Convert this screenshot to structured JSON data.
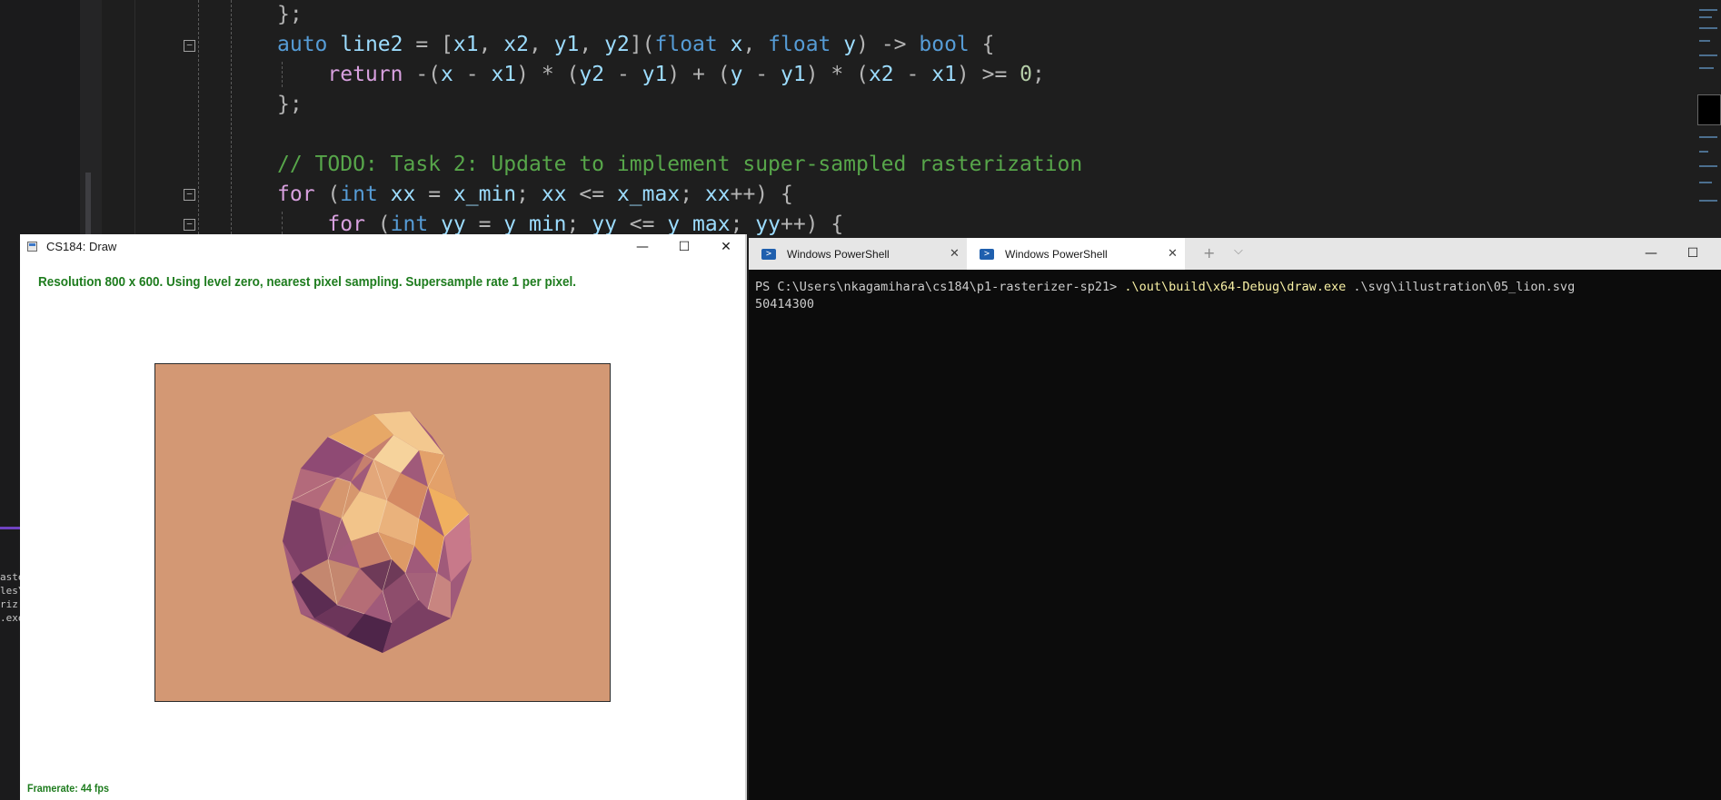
{
  "editor": {
    "lines": [
      {
        "tokens": [
          {
            "t": "};",
            "c": "op"
          }
        ]
      },
      {
        "tokens": [
          {
            "t": "auto ",
            "c": "kw"
          },
          {
            "t": "line2",
            "c": "id"
          },
          {
            "t": " = [",
            "c": "op"
          },
          {
            "t": "x1",
            "c": "id"
          },
          {
            "t": ", ",
            "c": "op"
          },
          {
            "t": "x2",
            "c": "id"
          },
          {
            "t": ", ",
            "c": "op"
          },
          {
            "t": "y1",
            "c": "id"
          },
          {
            "t": ", ",
            "c": "op"
          },
          {
            "t": "y2",
            "c": "id"
          },
          {
            "t": "](",
            "c": "op"
          },
          {
            "t": "float ",
            "c": "kw"
          },
          {
            "t": "x",
            "c": "id"
          },
          {
            "t": ", ",
            "c": "op"
          },
          {
            "t": "float ",
            "c": "kw"
          },
          {
            "t": "y",
            "c": "id"
          },
          {
            "t": ") -> ",
            "c": "op"
          },
          {
            "t": "bool",
            "c": "kw"
          },
          {
            "t": " {",
            "c": "op"
          }
        ]
      },
      {
        "tokens": [
          {
            "t": "    ",
            "c": "op"
          },
          {
            "t": "return ",
            "c": "ctl"
          },
          {
            "t": "-(",
            "c": "op"
          },
          {
            "t": "x",
            "c": "id"
          },
          {
            "t": " - ",
            "c": "op"
          },
          {
            "t": "x1",
            "c": "id"
          },
          {
            "t": ") * (",
            "c": "op"
          },
          {
            "t": "y2",
            "c": "id"
          },
          {
            "t": " - ",
            "c": "op"
          },
          {
            "t": "y1",
            "c": "id"
          },
          {
            "t": ") + (",
            "c": "op"
          },
          {
            "t": "y",
            "c": "id"
          },
          {
            "t": " - ",
            "c": "op"
          },
          {
            "t": "y1",
            "c": "id"
          },
          {
            "t": ") * (",
            "c": "op"
          },
          {
            "t": "x2",
            "c": "id"
          },
          {
            "t": " - ",
            "c": "op"
          },
          {
            "t": "x1",
            "c": "id"
          },
          {
            "t": ") >= ",
            "c": "op"
          },
          {
            "t": "0",
            "c": "num"
          },
          {
            "t": ";",
            "c": "op"
          }
        ]
      },
      {
        "tokens": [
          {
            "t": "};",
            "c": "op"
          }
        ]
      },
      {
        "tokens": []
      },
      {
        "tokens": [
          {
            "t": "// TODO: Task 2: Update to implement super-sampled rasterization",
            "c": "cm"
          }
        ]
      },
      {
        "tokens": [
          {
            "t": "for",
            "c": "ctl"
          },
          {
            "t": " (",
            "c": "op"
          },
          {
            "t": "int ",
            "c": "kw"
          },
          {
            "t": "xx",
            "c": "id"
          },
          {
            "t": " = ",
            "c": "op"
          },
          {
            "t": "x_min",
            "c": "id"
          },
          {
            "t": "; ",
            "c": "op"
          },
          {
            "t": "xx",
            "c": "id"
          },
          {
            "t": " <= ",
            "c": "op"
          },
          {
            "t": "x_max",
            "c": "id"
          },
          {
            "t": "; ",
            "c": "op"
          },
          {
            "t": "xx",
            "c": "id"
          },
          {
            "t": "++) {",
            "c": "op"
          }
        ]
      },
      {
        "tokens": [
          {
            "t": "    ",
            "c": "op"
          },
          {
            "t": "for",
            "c": "ctl"
          },
          {
            "t": " (",
            "c": "op"
          },
          {
            "t": "int ",
            "c": "kw"
          },
          {
            "t": "yy",
            "c": "id"
          },
          {
            "t": " = ",
            "c": "op"
          },
          {
            "t": "y_min",
            "c": "id"
          },
          {
            "t": "; ",
            "c": "op"
          },
          {
            "t": "yy",
            "c": "id"
          },
          {
            "t": " <= ",
            "c": "op"
          },
          {
            "t": "y_max",
            "c": "id"
          },
          {
            "t": "; ",
            "c": "op"
          },
          {
            "t": "yy",
            "c": "id"
          },
          {
            "t": "++) {",
            "c": "op"
          }
        ]
      }
    ],
    "side_fragments": [
      "aste",
      "les\\",
      "riz",
      ".exe"
    ]
  },
  "draw_window": {
    "title": "CS184: Draw",
    "status": "Resolution 800 x 600. Using level zero, nearest pixel sampling. Supersample rate 1 per pixel.",
    "framerate": "Framerate: 44 fps",
    "buttons": {
      "minimize": "—",
      "maximize": "☐",
      "close": "✕"
    }
  },
  "powershell": {
    "tabs": [
      {
        "label": "Windows PowerShell",
        "active": false
      },
      {
        "label": "Windows PowerShell",
        "active": true
      }
    ],
    "new_tab": "+",
    "dropdown": "⌵",
    "buttons": {
      "minimize": "—",
      "maximize": "☐"
    },
    "prompt": "PS C:\\Users\\nkagamihara\\cs184\\p1-rasterizer-sp21> ",
    "command": ".\\out\\build\\x64-Debug\\draw.exe",
    "args": " .\\svg\\illustration\\05_lion.svg",
    "output": "50414300"
  },
  "colors": {
    "canvas_bg": "#d39874",
    "status_green": "#1e7c1e",
    "terminal_bg": "#0c0c0c"
  }
}
